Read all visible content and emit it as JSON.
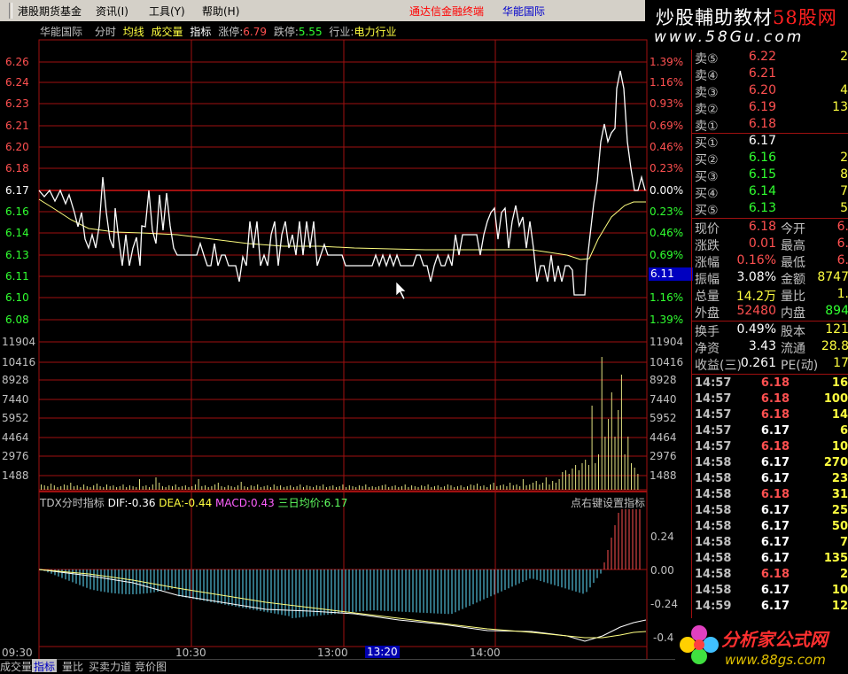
{
  "menu": {
    "items": [
      "港股期货基金",
      "资讯(I)",
      "工具(Y)",
      "帮助(H)"
    ],
    "ad": "通达信金融终端",
    "stock": "华能国际"
  },
  "brand": {
    "line1a": "炒股輔助教材",
    "line1b": "58股网",
    "line2": "www.58Gu.com"
  },
  "title": {
    "name": "华能国际",
    "tab1": "分时",
    "tab2": "均线",
    "tab3": "成交量",
    "tab4": "指标",
    "up_label": "涨停:",
    "up": "6.79",
    "down_label": "跌停:",
    "down": "5.55",
    "ind_label": "行业:",
    "industry": "电力行业"
  },
  "price_axis": {
    "left": [
      {
        "v": "6.26",
        "c": "#ff5050"
      },
      {
        "v": "6.24",
        "c": "#ff5050"
      },
      {
        "v": "6.23",
        "c": "#ff5050"
      },
      {
        "v": "6.21",
        "c": "#ff5050"
      },
      {
        "v": "6.20",
        "c": "#ff5050"
      },
      {
        "v": "6.18",
        "c": "#ff5050"
      },
      {
        "v": "6.17",
        "c": "#ffffff"
      },
      {
        "v": "6.16",
        "c": "#30ff30"
      },
      {
        "v": "6.14",
        "c": "#30ff30"
      },
      {
        "v": "6.13",
        "c": "#30ff30"
      },
      {
        "v": "6.11",
        "c": "#30ff30"
      },
      {
        "v": "6.10",
        "c": "#30ff30"
      },
      {
        "v": "6.08",
        "c": "#30ff30"
      }
    ],
    "right": [
      {
        "v": "1.39%",
        "c": "#ff5050"
      },
      {
        "v": "1.16%",
        "c": "#ff5050"
      },
      {
        "v": "0.93%",
        "c": "#ff5050"
      },
      {
        "v": "0.69%",
        "c": "#ff5050"
      },
      {
        "v": "0.46%",
        "c": "#ff5050"
      },
      {
        "v": "0.23%",
        "c": "#ff5050"
      },
      {
        "v": "0.00%",
        "c": "#ffffff"
      },
      {
        "v": "0.23%",
        "c": "#30ff30"
      },
      {
        "v": "0.46%",
        "c": "#30ff30"
      },
      {
        "v": "0.69%",
        "c": "#30ff30"
      },
      {
        "v": "1.16%",
        "c": "#30ff30"
      },
      {
        "v": "1.39%",
        "c": "#30ff30"
      }
    ],
    "current": "6.11"
  },
  "volume_axis": [
    "11904",
    "10416",
    "8928",
    "7440",
    "5952",
    "4464",
    "2976",
    "1488"
  ],
  "macd": {
    "name": "TDX分时指标",
    "dif": "DIF:-0.36",
    "dea": "DEA:-0.44",
    "macd": "MACD:0.43",
    "avg": "三日均价:6.17",
    "hint": "点右键设置指标",
    "axis": [
      "0.24",
      "0.00",
      "-0.24",
      "-0.4"
    ]
  },
  "time_axis": [
    "09:30",
    "10:30",
    "13:00",
    "13:20",
    "14:00"
  ],
  "bottom_tabs": [
    "成交量",
    "指标",
    "量比",
    "买卖力道",
    "竞价图"
  ],
  "quote": {
    "asks": [
      {
        "l": "卖⑤",
        "p": "6.22",
        "v": "2"
      },
      {
        "l": "卖④",
        "p": "6.21",
        "v": ""
      },
      {
        "l": "卖③",
        "p": "6.20",
        "v": "4"
      },
      {
        "l": "卖②",
        "p": "6.19",
        "v": "13"
      },
      {
        "l": "卖①",
        "p": "6.18",
        "v": ""
      }
    ],
    "bids": [
      {
        "l": "买①",
        "p": "6.17",
        "v": "",
        "c": "#ffffff"
      },
      {
        "l": "买②",
        "p": "6.16",
        "v": "2",
        "c": "#30ff30"
      },
      {
        "l": "买③",
        "p": "6.15",
        "v": "8",
        "c": "#30ff30"
      },
      {
        "l": "买④",
        "p": "6.14",
        "v": "7",
        "c": "#30ff30"
      },
      {
        "l": "买⑤",
        "p": "6.13",
        "v": "5",
        "c": "#30ff30"
      }
    ],
    "stats": [
      {
        "a": "现价",
        "av": "6.18",
        "ac": "#ff5050",
        "b": "今开",
        "bv": "6."
      },
      {
        "a": "涨跌",
        "av": "0.01",
        "ac": "#ff5050",
        "b": "最高",
        "bv": "6."
      },
      {
        "a": "涨幅",
        "av": "0.16%",
        "ac": "#ff5050",
        "b": "最低",
        "bv": "6."
      },
      {
        "a": "振幅",
        "av": "3.08%",
        "ac": "#ffffff",
        "b": "金额",
        "bv": "8747"
      },
      {
        "a": "总量",
        "av": "14.2万",
        "ac": "#ffff40",
        "b": "量比",
        "bv": "1."
      },
      {
        "a": "外盘",
        "av": "52480",
        "ac": "#ff5050",
        "b": "内盘",
        "bv": "894"
      },
      {
        "a": "换手",
        "av": "0.49%",
        "ac": "#ffffff",
        "b": "股本",
        "bv": "121"
      },
      {
        "a": "净资",
        "av": "3.43",
        "ac": "#ffffff",
        "b": "流通",
        "bv": "28.8"
      },
      {
        "a": "收益(三)",
        "av": "0.261",
        "ac": "#ffffff",
        "b": "PE(动)",
        "bv": "17"
      }
    ],
    "ticks": [
      {
        "t": "14:57",
        "p": "6.18",
        "v": "16"
      },
      {
        "t": "14:57",
        "p": "6.18",
        "v": "100"
      },
      {
        "t": "14:57",
        "p": "6.18",
        "v": "14"
      },
      {
        "t": "14:57",
        "p": "6.17",
        "v": "6"
      },
      {
        "t": "14:57",
        "p": "6.18",
        "v": "10"
      },
      {
        "t": "14:58",
        "p": "6.17",
        "v": "270"
      },
      {
        "t": "14:58",
        "p": "6.17",
        "v": "23"
      },
      {
        "t": "14:58",
        "p": "6.18",
        "v": "31"
      },
      {
        "t": "14:58",
        "p": "6.17",
        "v": "25"
      },
      {
        "t": "14:58",
        "p": "6.17",
        "v": "50"
      },
      {
        "t": "14:58",
        "p": "6.17",
        "v": "7"
      },
      {
        "t": "14:58",
        "p": "6.17",
        "v": "135"
      },
      {
        "t": "14:58",
        "p": "6.18",
        "v": "2"
      },
      {
        "t": "14:58",
        "p": "6.17",
        "v": "10"
      },
      {
        "t": "14:59",
        "p": "6.17",
        "v": "12"
      }
    ]
  },
  "corner": {
    "line1": "分析家公式网",
    "line2": "www.88gs.com"
  },
  "colors": {
    "up": "#ff5050",
    "down": "#30ff30",
    "grid": "#a01010",
    "price_line": "#ffffff",
    "avg_line": "#ffff80"
  }
}
